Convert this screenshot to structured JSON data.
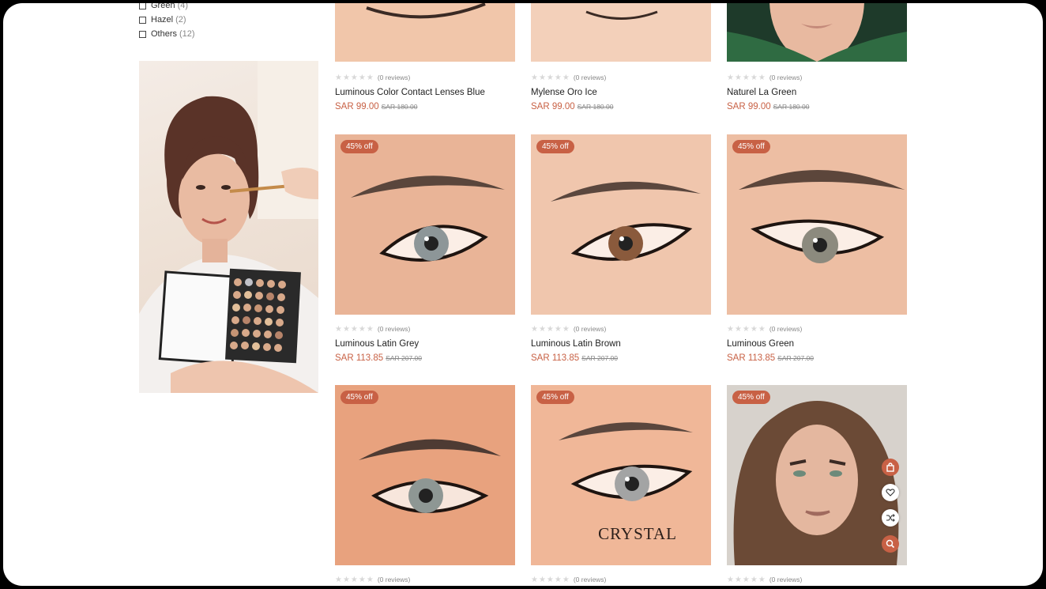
{
  "filters": [
    {
      "label": "Green",
      "count": "(4)"
    },
    {
      "label": "Hazel",
      "count": "(2)"
    },
    {
      "label": "Others",
      "count": "(12)"
    }
  ],
  "rows": [
    [
      {
        "name": "Luminous Color Contact Lenses Blue",
        "price": "SAR 99.00",
        "old": "SAR 180.00",
        "reviews": "(0 reviews)",
        "badge": ""
      },
      {
        "name": "Mylense Oro Ice",
        "price": "SAR 99.00",
        "old": "SAR 180.00",
        "reviews": "(0 reviews)",
        "badge": ""
      },
      {
        "name": "Naturel La Green",
        "price": "SAR 99.00",
        "old": "SAR 180.00",
        "reviews": "(0 reviews)",
        "badge": ""
      }
    ],
    [
      {
        "name": "Luminous Latin Grey",
        "price": "SAR 113.85",
        "old": "SAR 207.00",
        "reviews": "(0 reviews)",
        "badge": "45% off"
      },
      {
        "name": "Luminous Latin Brown",
        "price": "SAR 113.85",
        "old": "SAR 207.00",
        "reviews": "(0 reviews)",
        "badge": "45% off"
      },
      {
        "name": "Luminous Green",
        "price": "SAR 113.85",
        "old": "SAR 207.00",
        "reviews": "(0 reviews)",
        "badge": "45% off"
      }
    ],
    [
      {
        "name": "",
        "price": "",
        "old": "",
        "reviews": "(0 reviews)",
        "badge": "45% off",
        "overlay_text": ""
      },
      {
        "name": "",
        "price": "",
        "old": "",
        "reviews": "(0 reviews)",
        "badge": "45% off",
        "overlay_text": "CRYSTAL"
      },
      {
        "name": "",
        "price": "",
        "old": "",
        "reviews": "(0 reviews)",
        "badge": "45% off",
        "overlay_text": ""
      }
    ]
  ],
  "icons": {
    "add_to_cart": "cart-icon",
    "wishlist": "heart-icon",
    "compare": "shuffle-icon",
    "quick_view": "search-icon"
  },
  "colors": {
    "accent": "#c86145"
  }
}
